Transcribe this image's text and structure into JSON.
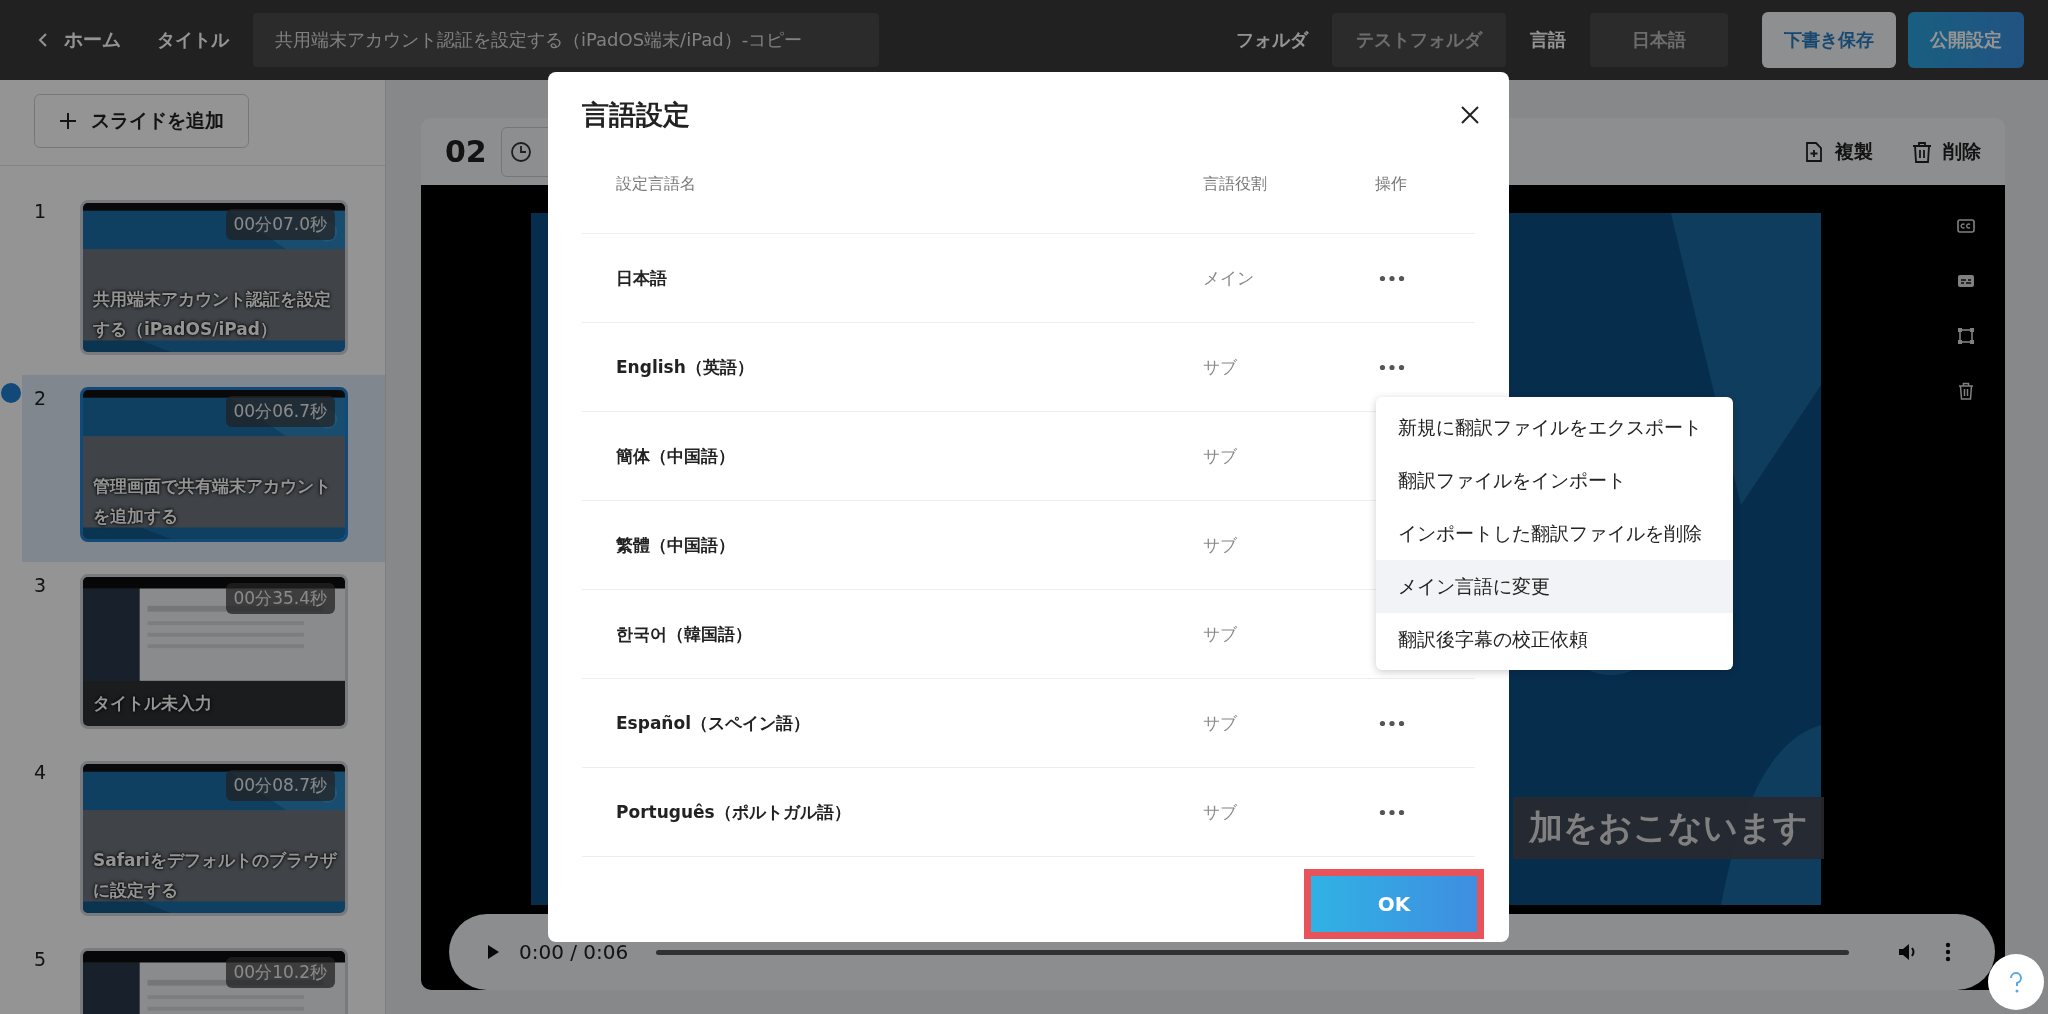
{
  "topbar": {
    "back_label": "ホーム",
    "title_label": "タイトル",
    "title_value": "共用端末アカウント認証を設定する（iPadOS端末/iPad）-コピー",
    "folder_label": "フォルダ",
    "folder_value": "テストフォルダ",
    "language_label": "言語",
    "language_value": "日本語",
    "buttons": [
      {
        "label": "下書き保存",
        "kind": "secondary"
      },
      {
        "label": "公開設定",
        "kind": "primary"
      }
    ]
  },
  "sidebar": {
    "add_button": "スライドを追加",
    "slides": [
      {
        "number": "1",
        "duration": "00分07.0秒",
        "caption": "共用端末アカウント認証を設定する（iPadOS/iPad）",
        "selected": false
      },
      {
        "number": "2",
        "duration": "00分06.7秒",
        "caption": "管理画面で共有端末アカウントを追加する",
        "selected": true
      },
      {
        "number": "3",
        "duration": "00分35.4秒",
        "caption": "タイトル未入力",
        "selected": false
      },
      {
        "number": "4",
        "duration": "00分08.7秒",
        "caption": "Safariをデフォルトのブラウザに設定する",
        "selected": false
      },
      {
        "number": "5",
        "duration": "00分10.2秒",
        "selected": false
      }
    ]
  },
  "editor": {
    "slide_number": "02",
    "actions": [
      {
        "label": "複製",
        "kind": "duplicate"
      },
      {
        "label": "削除",
        "kind": "delete"
      }
    ],
    "player": {
      "subtitle": "加をおこないます",
      "time": "0:00 / 0:06",
      "level": 0
    }
  },
  "modal": {
    "title": "言語設定",
    "columns": [
      "設定言語名",
      "言語役割",
      "操作"
    ],
    "rows": [
      {
        "name": "日本語",
        "role": "メイン"
      },
      {
        "name": "English（英語）",
        "role": "サブ",
        "menu": [
          {
            "label": "新規に翻訳ファイルをエクスポート",
            "selected": false
          },
          {
            "label": "翻訳ファイルをインポート",
            "selected": false
          },
          {
            "label": "インポートした翻訳ファイルを削除",
            "selected": false
          },
          {
            "label": "メイン言語に変更",
            "selected": true
          },
          {
            "label": "翻訳後字幕の校正依頼",
            "selected": false
          }
        ]
      },
      {
        "name": "簡体（中国語）",
        "role": "サブ"
      },
      {
        "name": "繁體（中国語）",
        "role": "サブ"
      },
      {
        "name": "한국어（韓国語）",
        "role": "サブ"
      },
      {
        "name": "Español（スペイン語）",
        "role": "サブ"
      },
      {
        "name": "Português（ポルトガル語）",
        "role": "サブ"
      }
    ],
    "ok_button": "OK"
  }
}
